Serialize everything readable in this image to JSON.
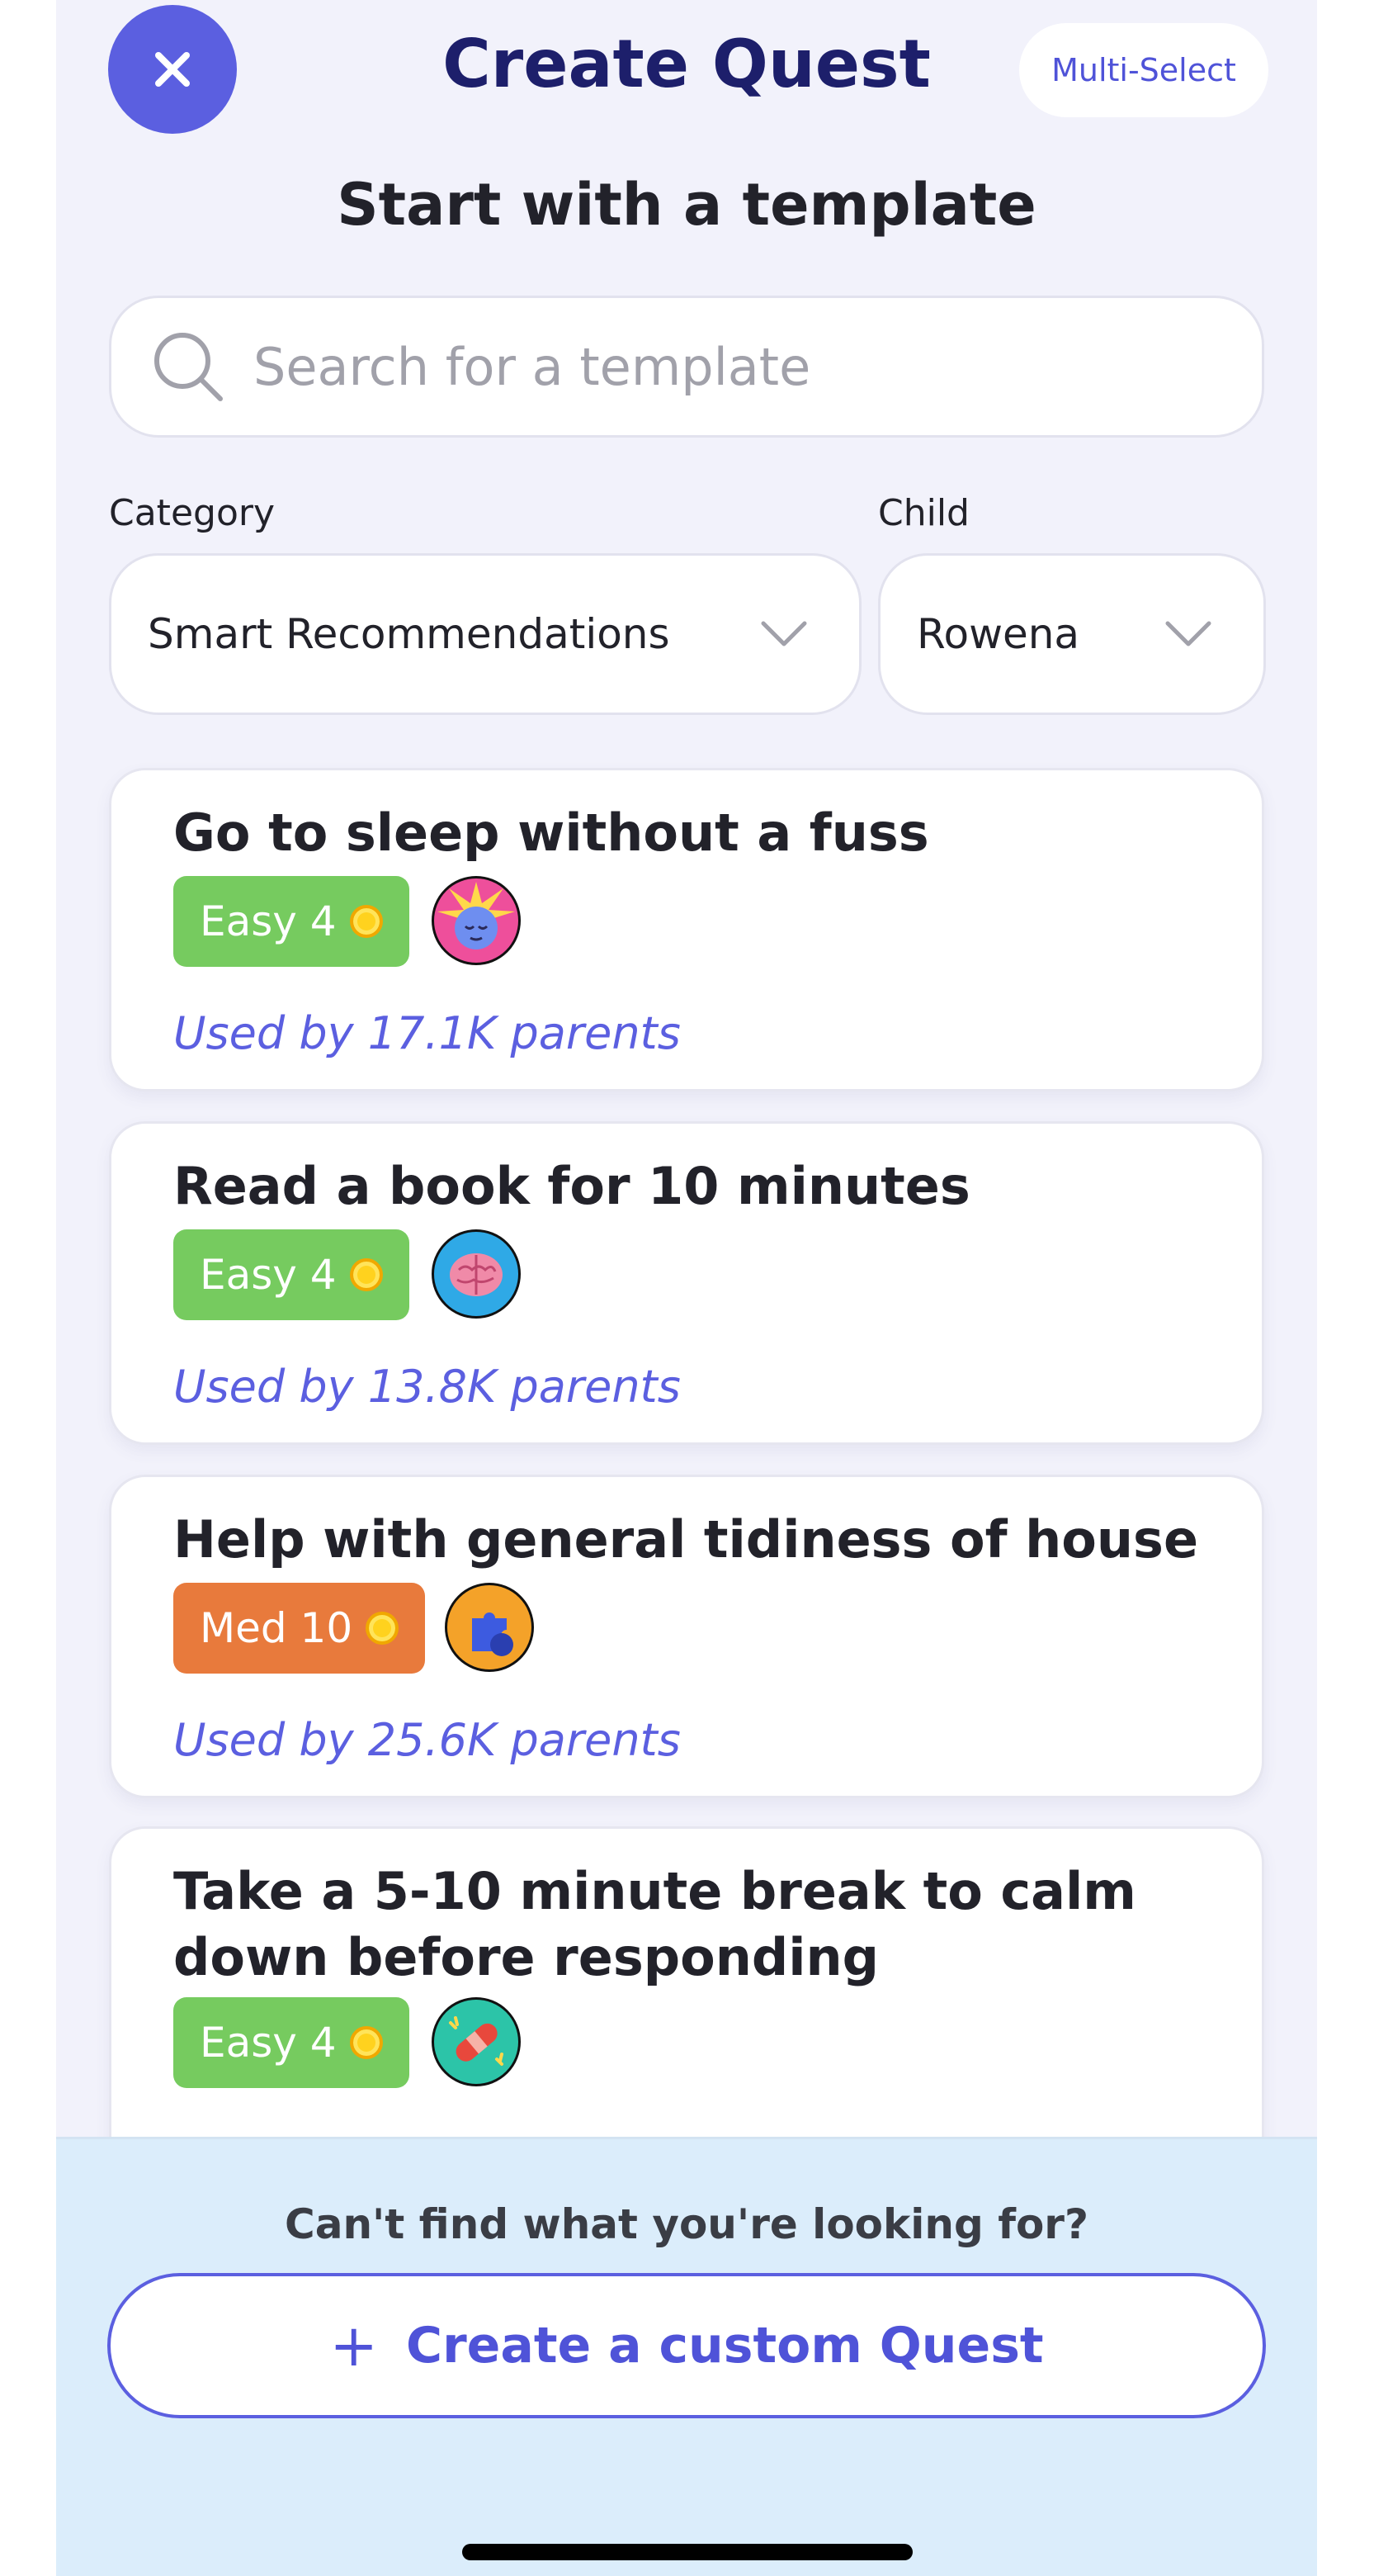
{
  "header": {
    "title": "Create Quest",
    "multi_select_label": "Multi-Select"
  },
  "subtitle": "Start with a template",
  "search": {
    "placeholder": "Search for a template",
    "value": ""
  },
  "filters": {
    "category_label": "Category",
    "category_value": "Smart Recommendations",
    "child_label": "Child",
    "child_value": "Rowena"
  },
  "templates": [
    {
      "title": "Go to sleep without a fuss",
      "difficulty": "Easy 4",
      "used_by": "Used by 17.1K parents",
      "icon": "sleepy-face-icon"
    },
    {
      "title": "Read a book for 10 minutes",
      "difficulty": "Easy 4",
      "used_by": "Used by 13.8K parents",
      "icon": "brain-icon"
    },
    {
      "title": "Help with general tidiness of house",
      "difficulty": "Med 10",
      "used_by": "Used by 25.6K parents",
      "icon": "puzzle-icon"
    },
    {
      "title": "Take a 5-10 minute break to calm down before responding",
      "difficulty": "Easy 4",
      "used_by": "",
      "icon": "bandage-icon"
    }
  ],
  "footer": {
    "prompt": "Can't find what you're looking for?",
    "custom_button_label": "Create a custom Quest",
    "plus_icon": "+"
  },
  "colors": {
    "accent": "#5b5fe0",
    "easy": "#76cb5f",
    "med": "#e87a3c",
    "background": "#f2f2fb",
    "footer_bg": "#dbedfb"
  }
}
